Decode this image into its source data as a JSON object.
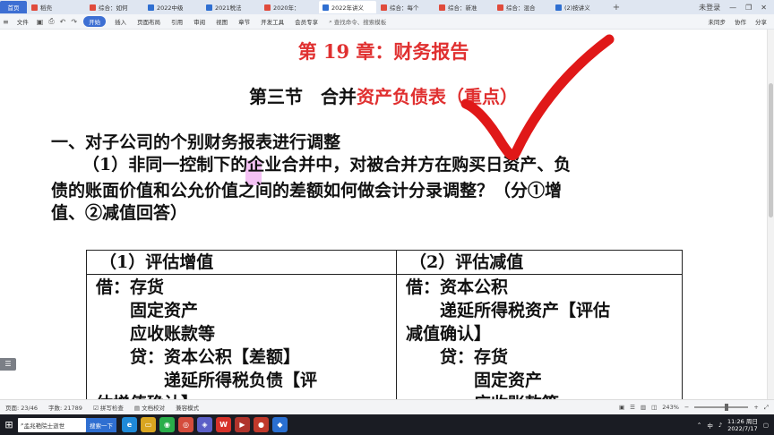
{
  "tabs": [
    {
      "label": "首页",
      "kind": "home",
      "color": "#3d6fd3"
    },
    {
      "label": "稻壳",
      "kind": "normal",
      "color": "#e04b3c"
    },
    {
      "label": "综合：如何",
      "kind": "normal",
      "color": "#e04b3c"
    },
    {
      "label": "2022中级",
      "kind": "normal",
      "color": "#2f6fd1"
    },
    {
      "label": "2021税法",
      "kind": "normal",
      "color": "#2f6fd1"
    },
    {
      "label": "2020年：",
      "kind": "normal",
      "color": "#e04b3c"
    },
    {
      "label": "2022年讲义",
      "kind": "active",
      "color": "#2f6fd1"
    },
    {
      "label": "综合：每个",
      "kind": "normal",
      "color": "#e04b3c"
    },
    {
      "label": "综合：新准",
      "kind": "normal",
      "color": "#e04b3c"
    },
    {
      "label": "综合：混合",
      "kind": "normal",
      "color": "#e04b3c"
    },
    {
      "label": "(2)按讲义",
      "kind": "normal",
      "color": "#2f6fd1"
    }
  ],
  "tab_add": "+",
  "window_controls": {
    "login": "未登录",
    "minimize": "—",
    "restore": "❐",
    "close": "✕"
  },
  "ribbon": {
    "file": "文件",
    "start": "开始",
    "items": [
      "插入",
      "页面布局",
      "引用",
      "审阅",
      "视图",
      "章节",
      "开发工具",
      "会员专享"
    ],
    "search": "查找命令、搜索模板",
    "right": [
      "未同步",
      "协作",
      "分享"
    ]
  },
  "doc": {
    "chapter_title": "第 19 章：财务报告",
    "section_prefix": "第三节　合并",
    "section_highlight": "资产负债表（重点）",
    "heading1": "一、对子公司的个别财务报表进行调整",
    "question_lines": [
      "（1）非同一控制下的企业合并中，对被合并方在购买日资产、负",
      "债的账面价值和公允价值之间的差额如何做会计分录调整？（分①增",
      "值、②减值回答）"
    ],
    "table": {
      "left_header": "（1）评估增值",
      "right_header": "（2）评估减值",
      "left_lines": [
        "借：存货",
        "　　固定资产",
        "　　应收账款等",
        "　　贷：资本公积【差额】",
        "　　　　递延所得税负债【评",
        "估增值确认】"
      ],
      "right_lines": [
        "借：资本公积",
        "　　递延所得税资产【评估",
        "减值确认】",
        "　　贷：存货",
        "　　　　固定资产",
        "　　　　应收账款等"
      ]
    },
    "accent_color": "#e03030"
  },
  "status": {
    "page": "页面: 23/46",
    "words": "字数: 21789",
    "spell": "拼写检查",
    "doc_check": "文档校对",
    "compat": "兼容模式",
    "zoom": "243%",
    "zoom_fraction": 0.6
  },
  "taskbar": {
    "search_text": "孟兆艳院士逝世",
    "search_btn": "搜索一下",
    "apps": [
      {
        "icon": "edge-icon",
        "glyph": "e",
        "color": "#1f8ad8"
      },
      {
        "icon": "folder-icon",
        "glyph": "▭",
        "color": "#d9a520"
      },
      {
        "icon": "wechat-icon",
        "glyph": "◉",
        "color": "#2aae4a"
      },
      {
        "icon": "chrome-icon",
        "glyph": "◎",
        "color": "#d44c3c"
      },
      {
        "icon": "app-icon",
        "glyph": "◈",
        "color": "#5b5fc7"
      },
      {
        "icon": "wps-icon",
        "glyph": "W",
        "color": "#d7322a"
      },
      {
        "icon": "media-icon",
        "glyph": "▶",
        "color": "#b0342c"
      },
      {
        "icon": "record-icon",
        "glyph": "●",
        "color": "#c0392b"
      },
      {
        "icon": "browser-icon",
        "glyph": "◆",
        "color": "#2a6fd1"
      }
    ],
    "ime": "中",
    "time": "11:26 周日",
    "date": "2022/7/17"
  }
}
